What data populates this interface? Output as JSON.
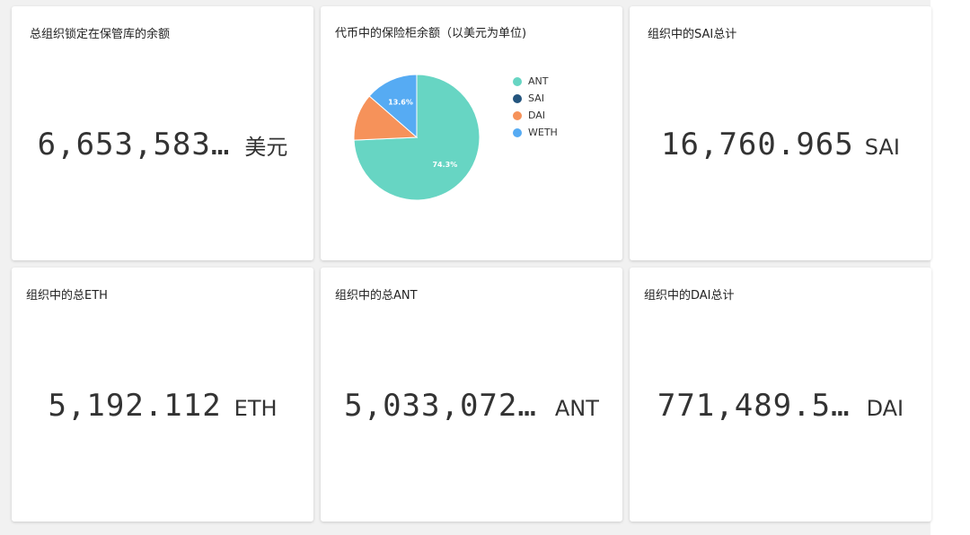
{
  "cards": {
    "total_locked": {
      "title": "总组织锁定在保管库的余额",
      "value": "6,653,583…",
      "unit": "美元"
    },
    "vault_balance_chart": {
      "title": "代币中的保险柜余额（以美元为单位)"
    },
    "sai_total": {
      "title": "组织中的SAI总计",
      "value": "16,760.965",
      "unit": "SAI"
    },
    "eth_total": {
      "title": "组织中的总ETH",
      "value": "5,192.112",
      "unit": "ETH"
    },
    "ant_total": {
      "title": "组织中的总ANT",
      "value": "5,033,072…",
      "unit": "ANT"
    },
    "dai_total": {
      "title": "组织中的DAI总计",
      "value": "771,489.5…",
      "unit": "DAI"
    }
  },
  "chart_data": {
    "type": "pie",
    "title": "代币中的保险柜余额（以美元为单位)",
    "legend_position": "right",
    "slices": [
      {
        "label": "ANT",
        "percent": 74.3,
        "color": "#67d5c3",
        "label_text": "74.3%"
      },
      {
        "label": "SAI",
        "percent": 0.0,
        "color": "#24557e",
        "label_text": ""
      },
      {
        "label": "DAI",
        "percent": 12.1,
        "color": "#f6925a",
        "label_text": ""
      },
      {
        "label": "WETH",
        "percent": 13.6,
        "color": "#56abf3",
        "label_text": "13.6%"
      }
    ]
  }
}
